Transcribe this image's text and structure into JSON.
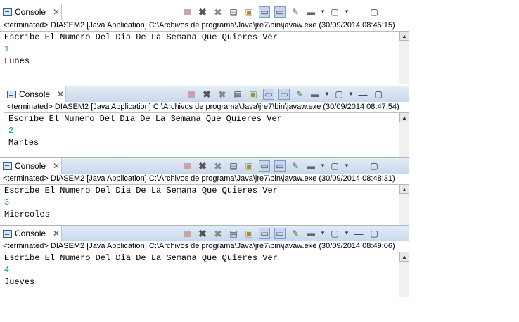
{
  "panels": [
    {
      "tab_label": "Console",
      "status": "<terminated> DIASEM2 [Java Application] C:\\Archivos de programa\\Java\\jre7\\bin\\javaw.exe (30/09/2014 08:45:15)",
      "prompt": "Escribe El Numero Del Dia De La Semana Que Quieres Ver",
      "input": "1",
      "output": "Lunes"
    },
    {
      "tab_label": "Console",
      "status": "<terminated> DIASEM2 [Java Application] C:\\Archivos de programa\\Java\\jre7\\bin\\javaw.exe (30/09/2014 08:47:54)",
      "prompt": "Escribe El Numero Del Dia De La Semana Que Quieres Ver",
      "input": "2",
      "output": "Martes"
    },
    {
      "tab_label": "Console",
      "status": "<terminated> DIASEM2 [Java Application] C:\\Archivos de programa\\Java\\jre7\\bin\\javaw.exe (30/09/2014 08:48:31)",
      "prompt": "Escribe El Numero Del Dia De La Semana Que Quieres Ver",
      "input": "3",
      "output": "Miercoles"
    },
    {
      "tab_label": "Console",
      "status": "<terminated> DIASEM2 [Java Application] C:\\Archivos de programa\\Java\\jre7\\bin\\javaw.exe (30/09/2014 08:49:06)",
      "prompt": "Escribe El Numero Del Dia De La Semana Que Quieres Ver",
      "input": "4",
      "output": "Jueves"
    }
  ],
  "icons": {
    "tab": "console-icon",
    "close": "close-icon",
    "toolbar": [
      "terminate-icon",
      "remove-launch-icon",
      "remove-all-terminated-icon",
      "clear-console-icon",
      "scroll-lock-icon",
      "show-on-stdout-icon",
      "show-on-stderr-icon",
      "pin-console-icon",
      "display-selected-console-icon",
      "open-console-icon",
      "minimize-icon",
      "maximize-icon"
    ]
  }
}
